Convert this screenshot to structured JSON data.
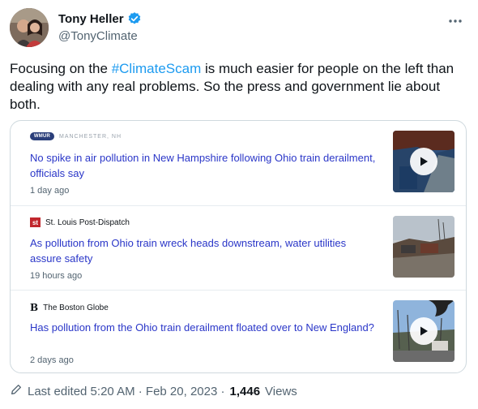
{
  "author": {
    "display_name": "Tony Heller",
    "handle": "@TonyClimate",
    "verified_icon": "verified-badge-icon",
    "badge_color": "#1d9bf0"
  },
  "more_icon": "more-horizontal-icon",
  "tweet": {
    "text_before": "Focusing on the ",
    "hashtag": "#ClimateScam",
    "text_after": " is much easier for people on the left than dealing with any real problems. So the press and government lie about both."
  },
  "news_card": {
    "items": [
      {
        "source_logo_text": "WMUR",
        "source_name": "MANCHESTER, NH",
        "headline": "No spike in air pollution in New Hampshire following Ohio train derailment, officials say",
        "age": "1 day ago",
        "has_video": true
      },
      {
        "source_logo_text": "st",
        "source_name": "St. Louis Post-Dispatch",
        "headline": "As pollution from Ohio train wreck heads downstream, water utilities assure safety",
        "age": "19 hours ago",
        "has_video": false
      },
      {
        "source_logo_text": "B",
        "source_name": "The Boston Globe",
        "headline": "Has pollution from the Ohio train derailment floated over to New England?",
        "age": "2 days ago",
        "has_video": true
      }
    ],
    "headline_color": "#2a36c8"
  },
  "footer": {
    "edit_icon": "pencil-icon",
    "edited_text": "Last edited 5:20 AM · Feb 20, 2023 · ",
    "views_count": "1,446",
    "views_label": "Views"
  },
  "colors": {
    "text": "#0f1419",
    "secondary": "#536471",
    "link": "#1d9bf0",
    "border": "#cfd9de"
  }
}
